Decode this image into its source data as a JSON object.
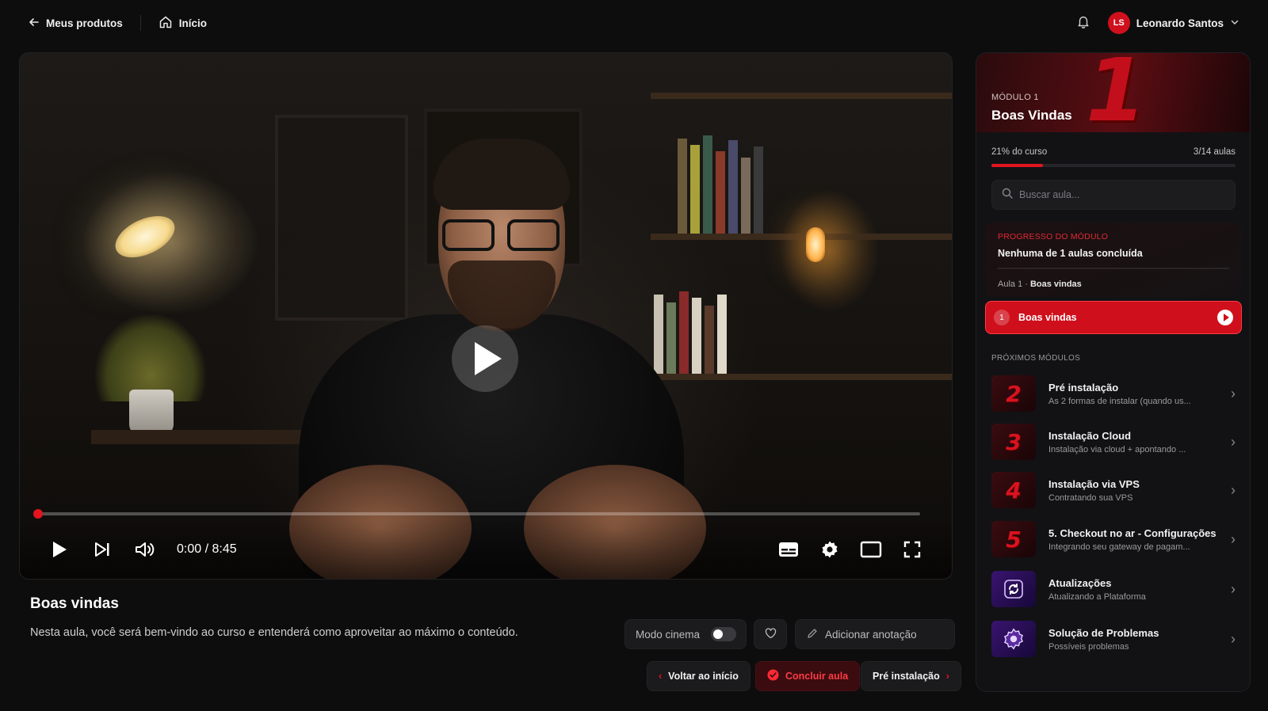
{
  "topbar": {
    "back_label": "Meus produtos",
    "home_label": "Início",
    "user_initials": "LS",
    "user_name": "Leonardo Santos"
  },
  "player": {
    "time": "0:00 / 8:45",
    "progress": 0
  },
  "lesson": {
    "title": "Boas vindas",
    "description": "Nesta aula, você será bem-vindo ao curso e entenderá como aproveitar ao máximo o conteúdo.",
    "cinema_label": "Modo cinema",
    "note_label": "Adicionar anotação",
    "back_label": "Voltar ao início",
    "complete_label": "Concluir aula",
    "next_label": "Pré instalação"
  },
  "sidebar": {
    "module_label": "MÓDULO 1",
    "module_number": "1",
    "module_title": "Boas Vindas",
    "course_progress_label": "21% do curso",
    "course_progress_value": 0.21,
    "lessons_count": "3/14 aulas",
    "search_placeholder": "Buscar aula...",
    "module_progress_label": "PROGRESSO DO MÓDULO",
    "module_progress_value": "Nenhuma de 1 aulas concluída",
    "current_lesson_prefix": "Aula 1 · ",
    "current_lesson_name": "Boas vindas",
    "active_lesson": {
      "number": "1",
      "title": "Boas vindas"
    },
    "next_modules_label": "PRÓXIMOS MÓDULOS",
    "next_modules": [
      {
        "thumb": "2",
        "title": "Pré instalação",
        "subtitle": "As 2 formas de instalar (quando us..."
      },
      {
        "thumb": "3",
        "title": "Instalação Cloud",
        "subtitle": "Instalação via cloud + apontando ..."
      },
      {
        "thumb": "4",
        "title": "Instalação via VPS",
        "subtitle": "Contratando sua VPS"
      },
      {
        "thumb": "5",
        "title": "5. Checkout no ar - Configurações",
        "subtitle": "Integrando seu gateway de pagam..."
      },
      {
        "thumb": "refresh-icon",
        "title": "Atualizações",
        "subtitle": "Atualizando a Plataforma"
      },
      {
        "thumb": "gear-icon",
        "title": "Solução de Problemas",
        "subtitle": "Possíveis problemas"
      }
    ]
  },
  "colors": {
    "accent": "#e3141f",
    "background": "#0d0d0e",
    "panel": "#121214"
  }
}
